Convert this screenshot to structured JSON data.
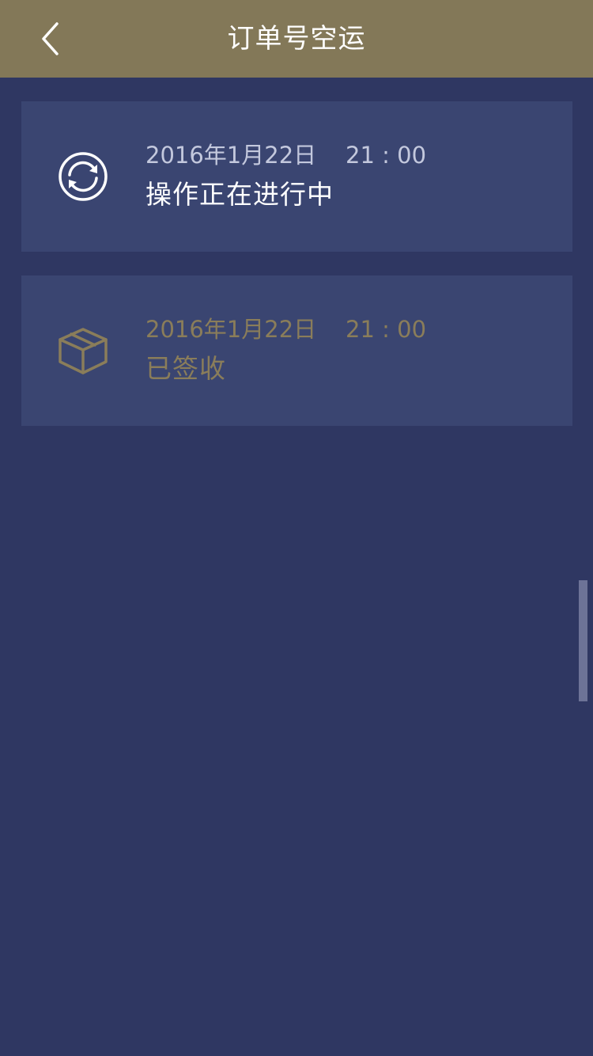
{
  "header": {
    "title": "订单号空运",
    "back_icon": "chevron-left-icon"
  },
  "timeline": [
    {
      "datetime": "2016年1月22日    21 : 00",
      "status": "操作正在进行中",
      "icon": "refresh-sync-icon",
      "text_color": "#ffffff"
    },
    {
      "datetime": "2016年1月22日    21 : 00",
      "status": "已签收",
      "icon": "package-box-icon",
      "text_color": "#8a7d5a"
    }
  ],
  "colors": {
    "header_bg": "#837858",
    "page_bg": "#2f3762",
    "card_bg": "#3a4571",
    "accent_gold": "#8a7d5a"
  }
}
